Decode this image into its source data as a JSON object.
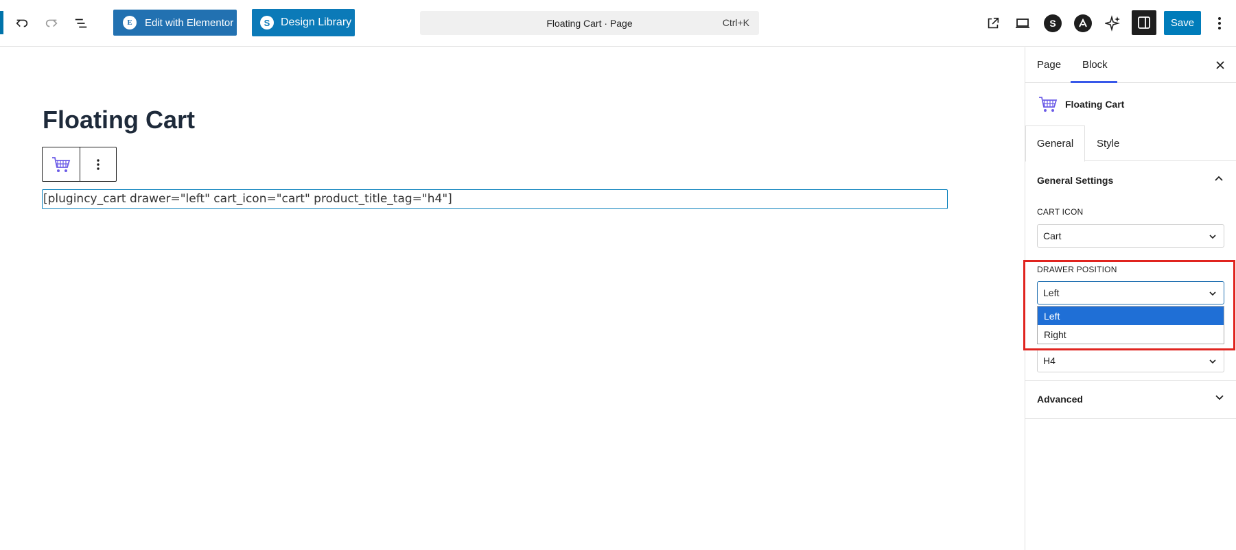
{
  "toolbar": {
    "elementor_label": "Edit with Elementor",
    "elementor_badge": "E",
    "design_library_label": "Design Library",
    "design_library_badge": "S",
    "command_title": "Floating Cart · Page",
    "command_shortcut": "Ctrl+K",
    "save_label": "Save",
    "icons": [
      "undo-icon",
      "redo-icon",
      "document-overview-icon",
      "external-link-icon",
      "device-preview-icon",
      "spectra-icon",
      "astra-icon",
      "ai-sparkle-icon",
      "settings-toggle-icon",
      "more-options-icon"
    ]
  },
  "canvas": {
    "page_title": "Floating Cart",
    "shortcode": "[plugincy_cart drawer=\"left\" cart_icon=\"cart\" product_title_tag=\"h4\"]"
  },
  "sidebar": {
    "tabs": [
      {
        "label": "Page"
      },
      {
        "label": "Block",
        "active": true
      }
    ],
    "block_title": "Floating Cart",
    "inner_tabs": [
      {
        "label": "General",
        "active": true
      },
      {
        "label": "Style"
      }
    ],
    "general_settings_title": "General Settings",
    "cart_icon_label": "CART ICON",
    "cart_icon_value": "Cart",
    "drawer_position_label": "DRAWER POSITION",
    "drawer_position_value": "Left",
    "drawer_options": [
      "Left",
      "Right"
    ],
    "hidden_select_value": "H4",
    "advanced_title": "Advanced"
  },
  "colors": {
    "accent": "#007cba",
    "tab_underline": "#3858e9",
    "dropdown_selected": "#1f6fd6",
    "highlight": "#e0241f",
    "cart_icon": "#6c5ce7"
  }
}
